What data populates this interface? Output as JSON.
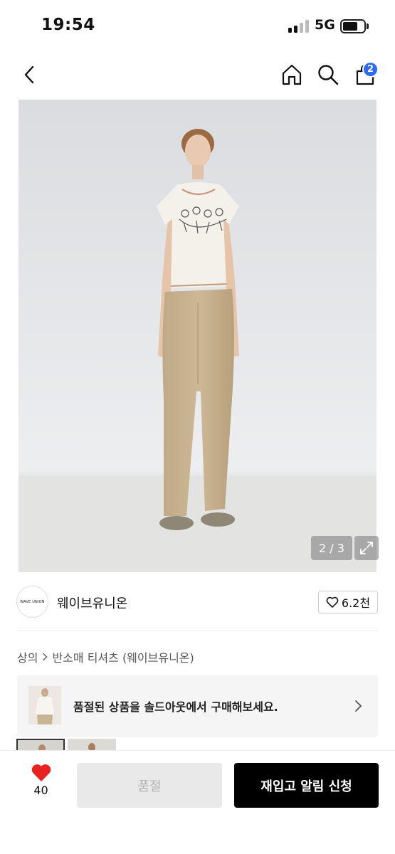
{
  "status_bar": {
    "time": "19:54",
    "network": "5G"
  },
  "nav": {
    "cart_count": "2"
  },
  "gallery": {
    "counter": "2 / 3"
  },
  "brand": {
    "logo_text": "WAVE UNION",
    "name": "웨이브유니온",
    "likes": "6.2천"
  },
  "breadcrumb": {
    "category": "상의",
    "subcategory": "반소매 티셔츠 (웨이브유니온)"
  },
  "soldout_banner": {
    "text": "품절된 상품을 솔드아웃에서 구매해보세요."
  },
  "bottom_bar": {
    "wish_count": "40",
    "soldout_label": "품절",
    "restock_label": "재입고 알림 신청"
  },
  "colors": {
    "accent_blue": "#2f6cf3",
    "heart_red": "#e8231f",
    "button_black": "#000000",
    "disabled_gray": "#e9e9e9"
  },
  "icons": [
    "back-icon",
    "home-icon",
    "search-icon",
    "cart-icon",
    "expand-icon",
    "heart-icon",
    "chevron-right-icon"
  ]
}
